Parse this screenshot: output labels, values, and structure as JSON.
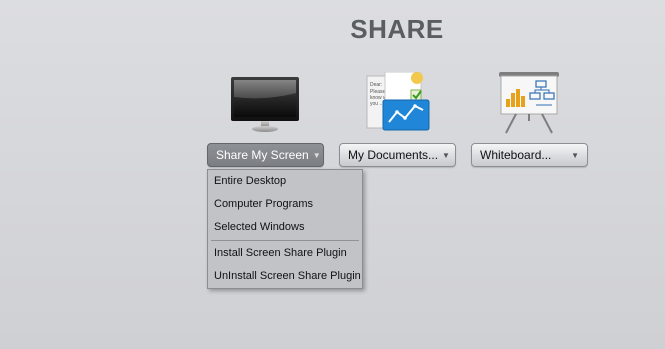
{
  "page": {
    "title": "SHARE"
  },
  "share_options": [
    {
      "label": "Share My Screen",
      "icon": "monitor-icon",
      "active": true
    },
    {
      "label": "My Documents...",
      "icon": "documents-icon",
      "active": false
    },
    {
      "label": "Whiteboard...",
      "icon": "whiteboard-icon",
      "active": false
    }
  ],
  "document_icon_text": "Dear:\nPlease let me know when you ...",
  "dropdown_menu": {
    "items": [
      "Entire Desktop",
      "Computer Programs",
      "Selected Windows"
    ],
    "plugin_items": [
      "Install Screen Share Plugin",
      "UnInstall Screen Share Plugin"
    ]
  }
}
